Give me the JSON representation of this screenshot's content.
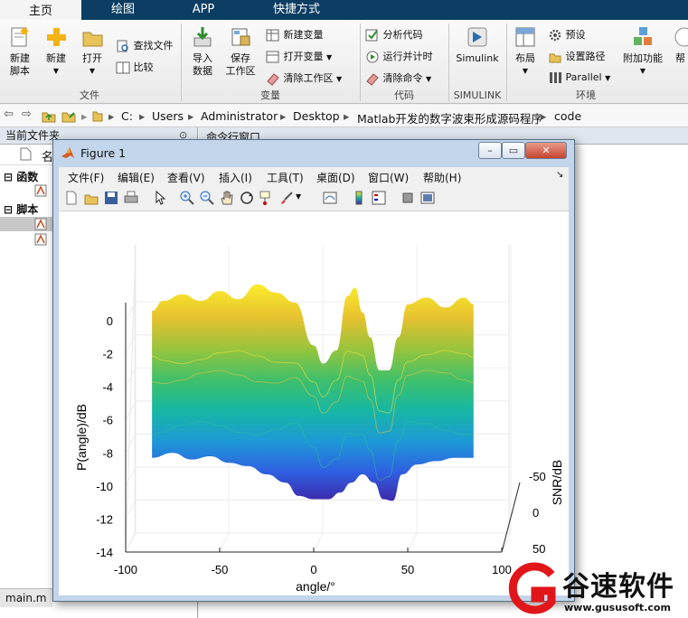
{
  "tabs": [
    "主页",
    "绘图",
    "APP",
    "快捷方式"
  ],
  "ribbon": {
    "new_script": "新建\n脚本",
    "new": "新建",
    "open": "打开",
    "find_files": "查找文件",
    "compare": "比较",
    "import_data": "导入\n数据",
    "save_workspace": "保存\n工作区",
    "new_variable": "新建变量",
    "open_variable": "打开变量",
    "clear_workspace": "清除工作区",
    "analyze_code": "分析代码",
    "run_and_time": "运行并计时",
    "clear_commands": "清除命令",
    "simulink": "Simulink",
    "layout": "布局",
    "preferences": "预设",
    "set_path": "设置路径",
    "parallel": "Parallel",
    "addons": "附加功能",
    "help_cut": "帮",
    "groups": {
      "file": "文件",
      "variable": "变量",
      "code": "代码",
      "simulink": "SIMULINK",
      "environment": "环境"
    }
  },
  "address": {
    "drive": "C:",
    "crumbs": [
      "Users",
      "Administrator",
      "Desktop",
      "Matlab开发的数字波束形成源码程序",
      "code"
    ]
  },
  "left_panel": {
    "title": "当前文件夹",
    "name_col": "名",
    "groups": [
      "函数",
      "脚本"
    ],
    "bottom_file": "main.m"
  },
  "cmd_title": "命令行窗口",
  "figure": {
    "title": "Figure 1",
    "menus": [
      "文件(F)",
      "编辑(E)",
      "查看(V)",
      "插入(I)",
      "工具(T)",
      "桌面(D)",
      "窗口(W)",
      "帮助(H)"
    ],
    "window_buttons": [
      "–",
      "▭",
      "✕"
    ]
  },
  "chart_data": {
    "type": "surface",
    "x_label": "angle/°",
    "y_label": "P(angle)/dB",
    "z_label": "SNR/dB",
    "x_ticks": [
      -100,
      -50,
      0,
      50,
      100
    ],
    "y_ticks": [
      0,
      -2,
      -4,
      -6,
      -8,
      -10,
      -12,
      -14
    ],
    "snr_ticks": [
      -50,
      0,
      50
    ],
    "xlim": [
      -100,
      100
    ],
    "ylim": [
      -14,
      0
    ],
    "colormap": [
      "#3e26a8",
      "#2f60e2",
      "#1d9ad6",
      "#17b7a3",
      "#3fc06a",
      "#97c43c",
      "#e6c12f",
      "#f9e82b"
    ],
    "top_envelope_db": [
      [
        -86,
        0.6
      ],
      [
        -80,
        1.2
      ],
      [
        -70,
        1.6
      ],
      [
        -60,
        1.2
      ],
      [
        -50,
        1.8
      ],
      [
        -40,
        1.3
      ],
      [
        -30,
        2.2
      ],
      [
        -20,
        1.7
      ],
      [
        -10,
        1.1
      ],
      [
        0,
        -1.5
      ],
      [
        5,
        -2.6
      ],
      [
        12,
        -1.8
      ],
      [
        18,
        1.5
      ],
      [
        22,
        2.0
      ],
      [
        26,
        0.5
      ],
      [
        30,
        -1.0
      ],
      [
        35,
        -3.0
      ],
      [
        40,
        -3.0
      ],
      [
        45,
        -1.0
      ],
      [
        50,
        1.0
      ],
      [
        60,
        1.4
      ],
      [
        70,
        0.8
      ],
      [
        80,
        1.4
      ],
      [
        85,
        1.0
      ]
    ],
    "bottom_envelope_db": [
      [
        -86,
        -8.3
      ],
      [
        -75,
        -8.0
      ],
      [
        -65,
        -8.4
      ],
      [
        -55,
        -8.2
      ],
      [
        -45,
        -8.6
      ],
      [
        -35,
        -8.8
      ],
      [
        -25,
        -9.3
      ],
      [
        -15,
        -9.8
      ],
      [
        -8,
        -10.6
      ],
      [
        0,
        -10.8
      ],
      [
        8,
        -10.8
      ],
      [
        14,
        -10.4
      ],
      [
        20,
        -9.8
      ],
      [
        26,
        -9.3
      ],
      [
        32,
        -9.8
      ],
      [
        37,
        -10.8
      ],
      [
        42,
        -10.9
      ],
      [
        47,
        -9.3
      ],
      [
        55,
        -8.7
      ],
      [
        65,
        -8.5
      ],
      [
        75,
        -8.3
      ],
      [
        85,
        -8.3
      ]
    ]
  },
  "watermark": {
    "brand": "谷速软件",
    "url": "www.gususoft.com"
  }
}
